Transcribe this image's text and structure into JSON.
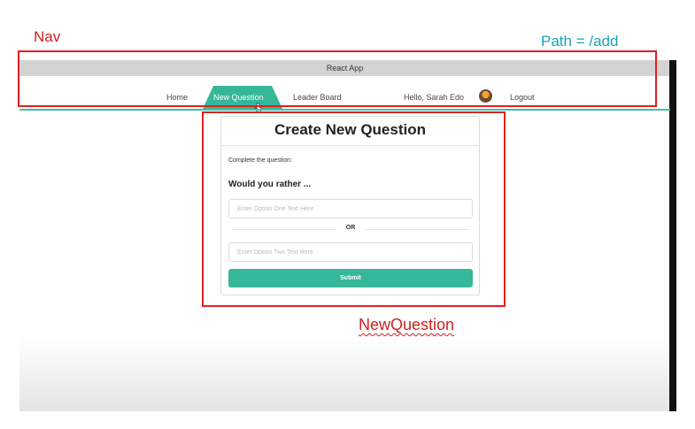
{
  "annotations": {
    "nav_label": "Nav",
    "path_label": "Path = /add",
    "new_question_label": "NewQuestion"
  },
  "window": {
    "title": "React App"
  },
  "nav": {
    "home": "Home",
    "new_question": "New Question",
    "leader_board": "Leader Board",
    "greeting": "Hello, Sarah Edo",
    "logout": "Logout"
  },
  "form": {
    "title": "Create New Question",
    "instruction": "Complete the question:",
    "prompt": "Would you rather ...",
    "option_one_placeholder": "Enter Option One Text Here",
    "or_label": "OR",
    "option_two_placeholder": "Enter Option Two Text Here",
    "submit_label": "Submit"
  },
  "colors": {
    "accent": "#36b79a",
    "annotation_red": "#e02020",
    "annotation_teal": "#1aa3b5"
  }
}
